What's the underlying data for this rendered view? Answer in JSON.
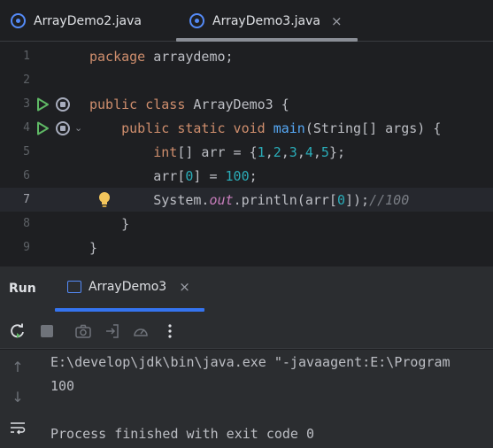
{
  "editor_tabs": [
    {
      "label": "ArrayDemo2.java"
    },
    {
      "label": "ArrayDemo3.java",
      "close": "×"
    }
  ],
  "code_lines": [
    {
      "num": "1",
      "code": "package arraydemo;"
    },
    {
      "num": "2",
      "code": ""
    },
    {
      "num": "3",
      "code": "public class ArrayDemo3 {"
    },
    {
      "num": "4",
      "code": "    public static void main(String[] args) {"
    },
    {
      "num": "5",
      "code": "        int[] arr = {1,2,3,4,5};"
    },
    {
      "num": "6",
      "code": "        arr[0] = 100;"
    },
    {
      "num": "7",
      "code": "        System.out.println(arr[0]);//100"
    },
    {
      "num": "8",
      "code": "    }"
    },
    {
      "num": "9",
      "code": "}"
    }
  ],
  "run_panel": {
    "title": "Run",
    "tab_label": "ArrayDemo3",
    "tab_close": "×"
  },
  "console": {
    "lines": [
      "E:\\develop\\jdk\\bin\\java.exe \"-javaagent:E:\\Program",
      "100",
      "",
      "Process finished with exit code 0"
    ]
  },
  "colors": {
    "keyword": "#cf8e6d",
    "method": "#56a8f5",
    "number": "#2aacb8",
    "static_field": "#c77dbb",
    "comment": "#7a7e85",
    "run_green": "#5fb865",
    "accent_blue": "#3574f0"
  }
}
